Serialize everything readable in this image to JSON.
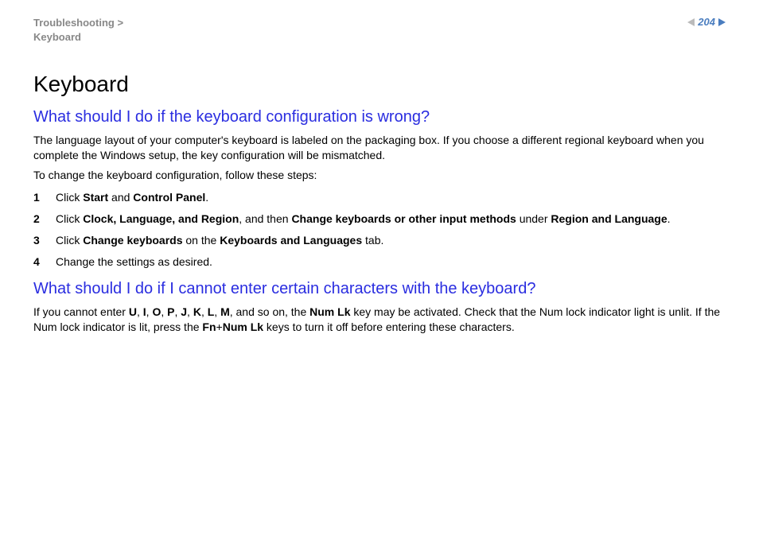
{
  "breadcrumb": {
    "line1": "Troubleshooting",
    "line2": "Keyboard"
  },
  "page_number": "204",
  "h1": "Keyboard",
  "section1": {
    "heading": "What should I do if the keyboard configuration is wrong?",
    "para1": "The language layout of your computer's keyboard is labeled on the packaging box. If you choose a different regional keyboard when you complete the Windows setup, the key configuration will be mismatched.",
    "para2": "To change the keyboard configuration, follow these steps:",
    "steps": {
      "s1": {
        "num": "1",
        "pre": "Click ",
        "b1": "Start",
        "mid1": " and ",
        "b2": "Control Panel",
        "post": "."
      },
      "s2": {
        "num": "2",
        "pre": "Click ",
        "b1": "Clock, Language, and Region",
        "mid1": ", and then ",
        "b2": "Change keyboards or other input methods",
        "mid2": " under ",
        "b3": "Region and Language",
        "post": "."
      },
      "s3": {
        "num": "3",
        "pre": "Click ",
        "b1": "Change keyboards",
        "mid1": " on the ",
        "b2": "Keyboards and Languages",
        "post": " tab."
      },
      "s4": {
        "num": "4",
        "text": "Change the settings as desired."
      }
    }
  },
  "section2": {
    "heading": "What should I do if I cannot enter certain characters with the keyboard?",
    "para": {
      "t1": "If you cannot enter ",
      "k1": "U",
      "c1": ", ",
      "k2": "I",
      "c2": ", ",
      "k3": "O",
      "c3": ", ",
      "k4": "P",
      "c4": ", ",
      "k5": "J",
      "c5": ", ",
      "k6": "K",
      "c6": ", ",
      "k7": "L",
      "c7": ", ",
      "k8": "M",
      "t2": ", and so on, the ",
      "b1": "Num Lk",
      "t3": " key may be activated. Check that the Num lock indicator light is unlit. If the Num lock indicator is lit, press the ",
      "b2": "Fn",
      "plus": "+",
      "b3": "Num Lk",
      "t4": " keys to turn it off before entering these characters."
    }
  }
}
